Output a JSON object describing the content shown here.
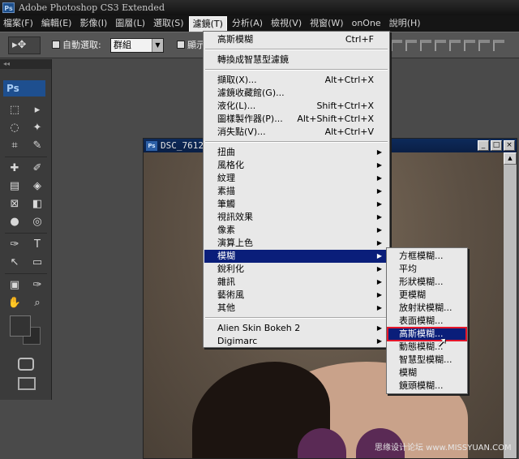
{
  "app": {
    "title": "Adobe Photoshop CS3 Extended",
    "badge": "Ps"
  },
  "menubar": {
    "items": [
      {
        "label": "檔案(F)"
      },
      {
        "label": "編輯(E)"
      },
      {
        "label": "影像(I)"
      },
      {
        "label": "圖層(L)"
      },
      {
        "label": "選取(S)"
      },
      {
        "label": "濾鏡(T)"
      },
      {
        "label": "分析(A)"
      },
      {
        "label": "檢視(V)"
      },
      {
        "label": "視窗(W)"
      },
      {
        "label": "onOne"
      },
      {
        "label": "說明(H)"
      }
    ]
  },
  "options_bar": {
    "tool_glyph": "▸✥",
    "auto_select_label": "自動選取:",
    "auto_select_value": "群組",
    "show_label": "顯示"
  },
  "tools_panel": {
    "logo": "Ps",
    "collapse_glyph": "◂◂",
    "tools": [
      "⬚",
      "▸",
      "◌",
      "✦",
      "⌗",
      "✎",
      "✚",
      "✐",
      "▤",
      "◈",
      "⊠",
      "◧",
      "●",
      "◎",
      "✑",
      "T",
      "↖",
      "▭",
      "▣",
      "✑",
      "✋",
      "⌕"
    ]
  },
  "document": {
    "title": "DSC_7612",
    "badge": "Ps",
    "minimize": "_",
    "restore": "□",
    "close": "×",
    "scroll_up": "▲"
  },
  "filter_menu": {
    "items": [
      {
        "label": "高斯模糊",
        "shortcut": "Ctrl+F"
      },
      {
        "label": "轉換成智慧型濾鏡",
        "shortcut": ""
      },
      {
        "label": "擷取(X)...",
        "shortcut": "Alt+Ctrl+X"
      },
      {
        "label": "濾鏡收藏館(G)...",
        "shortcut": ""
      },
      {
        "label": "液化(L)...",
        "shortcut": "Shift+Ctrl+X"
      },
      {
        "label": "圖樣製作器(P)...",
        "shortcut": "Alt+Shift+Ctrl+X"
      },
      {
        "label": "消失點(V)...",
        "shortcut": "Alt+Ctrl+V"
      },
      {
        "label": "扭曲",
        "shortcut": ""
      },
      {
        "label": "風格化",
        "shortcut": ""
      },
      {
        "label": "紋理",
        "shortcut": ""
      },
      {
        "label": "素描",
        "shortcut": ""
      },
      {
        "label": "筆觸",
        "shortcut": ""
      },
      {
        "label": "視訊效果",
        "shortcut": ""
      },
      {
        "label": "像素",
        "shortcut": ""
      },
      {
        "label": "演算上色",
        "shortcut": ""
      },
      {
        "label": "模糊",
        "shortcut": ""
      },
      {
        "label": "銳利化",
        "shortcut": ""
      },
      {
        "label": "雜訊",
        "shortcut": ""
      },
      {
        "label": "藝術風",
        "shortcut": ""
      },
      {
        "label": "其他",
        "shortcut": ""
      },
      {
        "label": "Alien Skin Bokeh 2",
        "shortcut": ""
      },
      {
        "label": "Digimarc",
        "shortcut": ""
      }
    ],
    "submenu_arrow": "▶"
  },
  "blur_menu": {
    "items": [
      {
        "label": "方框模糊..."
      },
      {
        "label": "平均"
      },
      {
        "label": "形狀模糊..."
      },
      {
        "label": "更模糊"
      },
      {
        "label": "放射狀模糊..."
      },
      {
        "label": "表面模糊..."
      },
      {
        "label": "高斯模糊..."
      },
      {
        "label": "動態模糊..."
      },
      {
        "label": "智慧型模糊..."
      },
      {
        "label": "模糊"
      },
      {
        "label": "鏡頭模糊..."
      }
    ]
  },
  "cursor_glyph": "➚",
  "watermark": "思缘设计论坛 www.MISSYUAN.COM",
  "colors": {
    "menu_highlight": "#0a1e7a",
    "selection_outline": "#e5162a"
  }
}
